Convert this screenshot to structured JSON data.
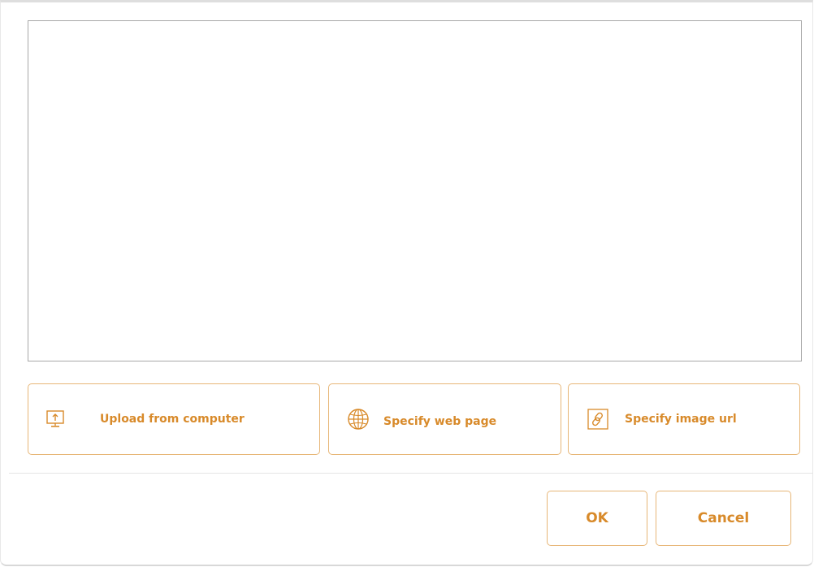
{
  "source_buttons": {
    "upload": {
      "label": "Upload from computer",
      "icon": "upload-monitor-icon"
    },
    "web_page": {
      "label": "Specify web page",
      "icon": "globe-icon"
    },
    "image_url": {
      "label": "Specify image url",
      "icon": "link-icon"
    }
  },
  "footer": {
    "ok_label": "OK",
    "cancel_label": "Cancel"
  },
  "colors": {
    "accent": "#d88a2a",
    "button_border": "#e7b677",
    "preview_border": "#a8a8a8"
  }
}
